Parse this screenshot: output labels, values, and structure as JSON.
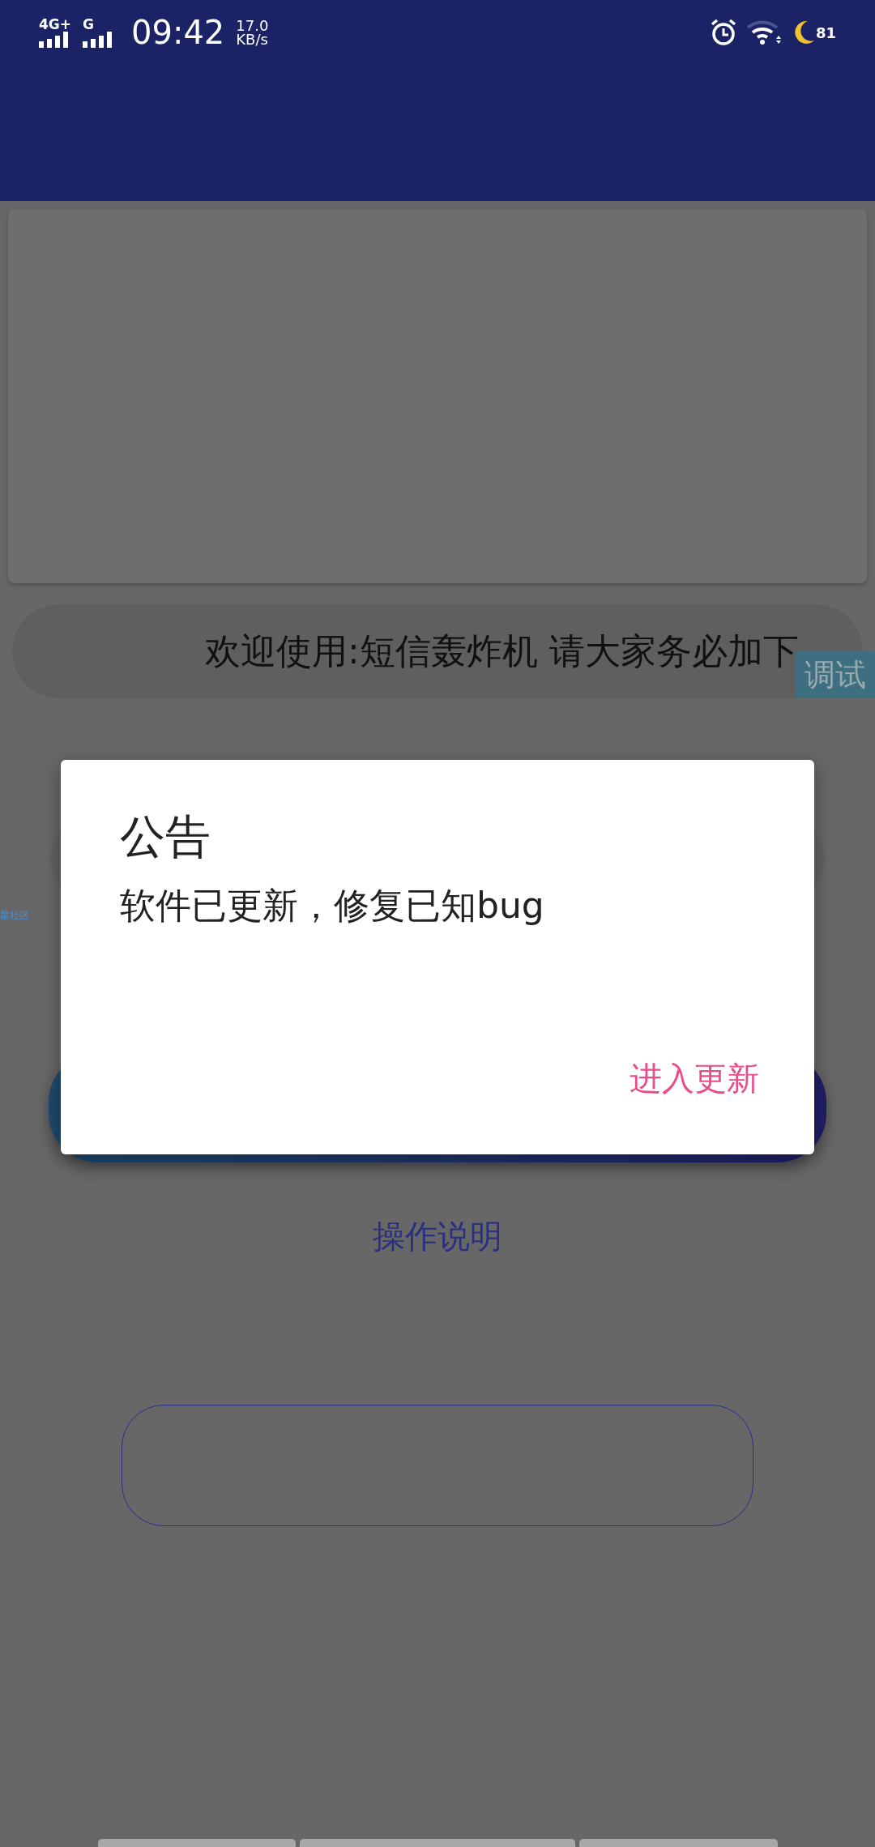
{
  "status_bar": {
    "networks": [
      "4G+",
      "G"
    ],
    "time": "09:42",
    "speed": "17.0",
    "speed_unit": "KB/s",
    "battery": "81"
  },
  "banner_text": "欢迎使用:短信轰炸机 请大家务必加下",
  "debug_badge": "调试",
  "side_label": "星社区",
  "dialog": {
    "title": "公告",
    "message": "软件已更新，修复已知bug",
    "button": "进入更新"
  },
  "help_link": "操作说明"
}
